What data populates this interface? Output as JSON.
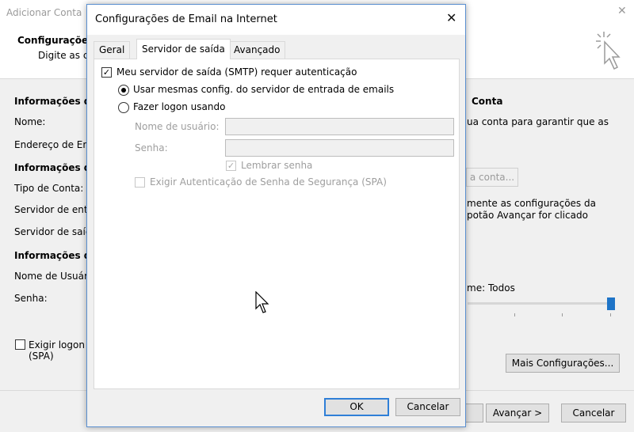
{
  "background_window": {
    "title": "Adicionar Conta",
    "heading": "Configurações",
    "subheading": "Digite as co",
    "sections": {
      "user_info": "Informações do",
      "server_info": "Informações do",
      "logon_info": "Informações de"
    },
    "labels": {
      "name": "Nome:",
      "email": "Endereço de Em",
      "account_type": "Tipo de Conta:",
      "incoming": "Servidor de entr",
      "outgoing": "Servidor de saíd",
      "username": "Nome de Usuár",
      "password": "Senha:"
    },
    "right_panel": {
      "heading": "Conta",
      "text_line1": "ua conta para garantir que as",
      "test_button": "a conta...",
      "text2_line1": "mente as configurações da",
      "text2_line2": "potão Avançar for clicado",
      "mail_to_keep_label": "me:",
      "mail_to_keep_value": "Todos",
      "slider_level_pct": 100
    },
    "spa_checkbox": {
      "line1": "Exigir logon",
      "line2": "(SPA)",
      "checked": false
    },
    "buttons": {
      "more_settings": "Mais Configurações...",
      "next": "Avançar >",
      "cancel": "Cancelar"
    }
  },
  "dialog": {
    "title": "Configurações de Email na Internet",
    "close_glyph": "✕",
    "tabs": [
      {
        "label": "Geral",
        "active": false
      },
      {
        "label": "Servidor de saída",
        "active": true
      },
      {
        "label": "Avançado",
        "active": false
      }
    ],
    "smtp_auth": {
      "label": "Meu servidor de saída (SMTP) requer autenticação",
      "checked": true
    },
    "options": {
      "use_same": {
        "label": "Usar mesmas config. do servidor de entrada de emails",
        "selected": true
      },
      "logon_using": {
        "label": "Fazer logon usando",
        "selected": false
      }
    },
    "fields": {
      "username_label": "Nome de usuário:",
      "username_value": "",
      "password_label": "Senha:",
      "password_value": ""
    },
    "remember_password": {
      "label": "Lembrar senha",
      "checked": true
    },
    "spa": {
      "label": "Exigir Autenticação de Senha de Segurança (SPA)",
      "checked": false
    },
    "buttons": {
      "ok": "OK",
      "cancel": "Cancelar"
    }
  },
  "icons": {
    "check_glyph": "✓",
    "accent": "#2f7fd7"
  }
}
